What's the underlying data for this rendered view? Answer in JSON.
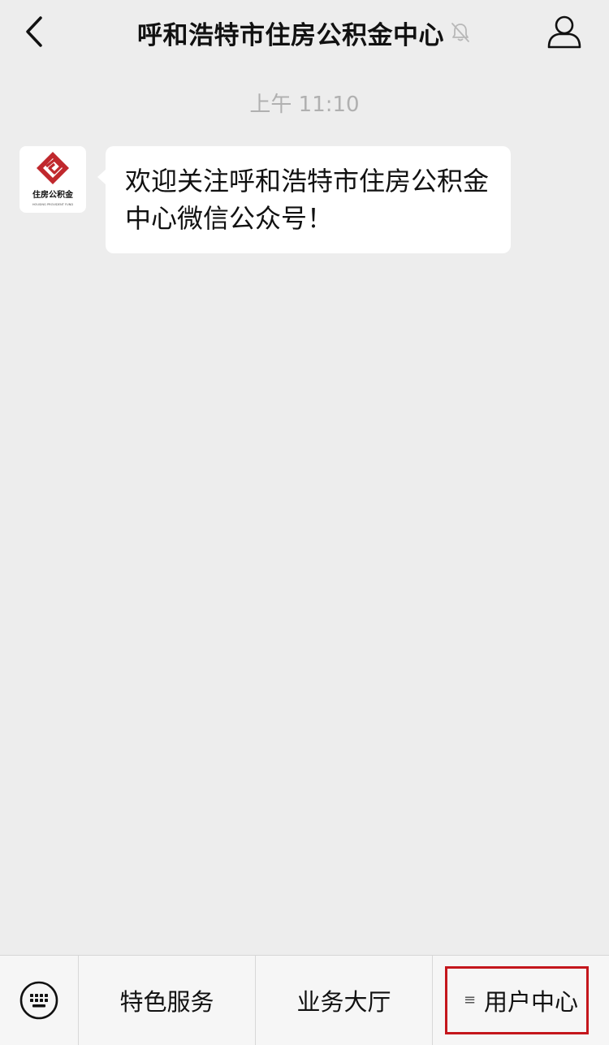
{
  "header": {
    "title": "呼和浩特市住房公积金中心",
    "back_icon": "chevron-left-icon",
    "mute_icon": "bell-off-icon",
    "profile_icon": "person-icon"
  },
  "chat": {
    "timestamp": "上午 11:10",
    "avatar": {
      "logo_text": "住房公积金",
      "logo_subtext": "HOUSING PROVIDENT FUND",
      "logo_color": "#c0282d"
    },
    "message": "欢迎关注呼和浩特市住房公积金中心微信公众号！"
  },
  "menu": {
    "keyboard_icon": "keyboard-icon",
    "items": [
      {
        "label": "特色服务"
      },
      {
        "label": "业务大厅"
      },
      {
        "label": "用户中心",
        "has_submenu": true
      }
    ],
    "highlight_color": "#c4161c"
  }
}
